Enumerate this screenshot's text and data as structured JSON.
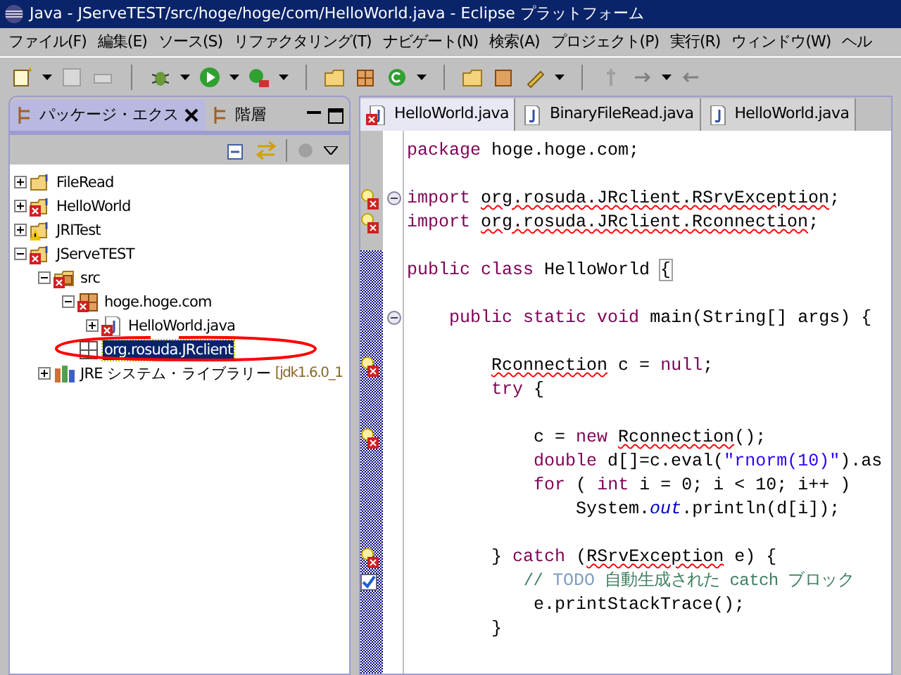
{
  "window": {
    "title": "Java - JServeTEST/src/hoge/hoge/com/HelloWorld.java - Eclipse プラットフォーム"
  },
  "menu": [
    "ファイル(F)",
    "編集(E)",
    "ソース(S)",
    "リファクタリング(T)",
    "ナビゲート(N)",
    "検索(A)",
    "プロジェクト(P)",
    "実行(R)",
    "ウィンドウ(W)",
    "ヘル"
  ],
  "side_tabs": [
    {
      "label": "パッケージ・エクス",
      "selected": true
    },
    {
      "label": "階層",
      "selected": false
    }
  ],
  "tree": [
    {
      "label": "FileRead",
      "kind": "project",
      "error": false,
      "warning": false,
      "expanded": false,
      "selected": false
    },
    {
      "label": "HelloWorld",
      "kind": "project",
      "error": true,
      "warning": false,
      "expanded": false,
      "selected": false
    },
    {
      "label": "JRITest",
      "kind": "project",
      "error": false,
      "warning": true,
      "expanded": false,
      "selected": false
    },
    {
      "label": "JServeTEST",
      "kind": "project",
      "error": true,
      "warning": false,
      "expanded": true,
      "selected": false,
      "children": [
        {
          "label": "src",
          "kind": "folder",
          "error": true,
          "warning": false,
          "expanded": true,
          "selected": false,
          "children": [
            {
              "label": "hoge.hoge.com",
              "kind": "package",
              "error": true,
              "warning": false,
              "expanded": true,
              "selected": false,
              "children": [
                {
                  "label": "HelloWorld.java",
                  "kind": "file",
                  "error": true,
                  "warning": false,
                  "expanded": false,
                  "selected": false
                }
              ]
            },
            {
              "label": "org.rosuda.JRclient",
              "kind": "empty",
              "error": false,
              "warning": false,
              "selected": true
            }
          ]
        },
        {
          "label": "JRE システム・ライブラリー",
          "kind": "library",
          "error": false,
          "warning": false,
          "decoration": "[jdk1.6.0_1",
          "expanded": false,
          "selected": false
        }
      ]
    }
  ],
  "editor_tabs": [
    {
      "label": "HelloWorld.java",
      "error": true,
      "selected": true
    },
    {
      "label": "BinaryFileRead.java",
      "error": false,
      "selected": false
    },
    {
      "label": "HelloWorld.java",
      "error": false,
      "selected": false
    }
  ],
  "code": [
    {
      "kind": "code",
      "error": false,
      "task": false,
      "foldable": false,
      "segments": [
        {
          "kind": "keyword",
          "text": "package"
        },
        {
          "kind": "plain",
          "text": " hoge.hoge.com;"
        }
      ]
    },
    {
      "kind": "blank"
    },
    {
      "kind": "code",
      "error": true,
      "task": false,
      "foldable": true,
      "segments": [
        {
          "kind": "keyword",
          "text": "import "
        },
        {
          "kind": "plain",
          "text": "org.rosuda.JRclient.RSrvException",
          "error": true
        },
        {
          "kind": "plain",
          "text": ";"
        }
      ]
    },
    {
      "kind": "code",
      "error": true,
      "task": false,
      "foldable": false,
      "segments": [
        {
          "kind": "keyword",
          "text": "import "
        },
        {
          "kind": "plain",
          "text": "org.rosuda.JRclient.Rconnection",
          "error": true
        },
        {
          "kind": "plain",
          "text": ";"
        }
      ]
    },
    {
      "kind": "blank"
    },
    {
      "kind": "code",
      "error": false,
      "task": false,
      "foldable": false,
      "segments": [
        {
          "kind": "keyword",
          "text": "public class"
        },
        {
          "kind": "plain",
          "text": " HelloWorld "
        },
        {
          "kind": "bracket",
          "text": "{"
        }
      ]
    },
    {
      "kind": "blank"
    },
    {
      "kind": "code",
      "error": false,
      "task": false,
      "foldable": true,
      "segments": [
        {
          "kind": "keyword",
          "text": "    public static void"
        },
        {
          "kind": "plain",
          "text": " main(String[] args) {"
        }
      ]
    },
    {
      "kind": "blank"
    },
    {
      "kind": "code",
      "error": true,
      "task": false,
      "foldable": false,
      "segments": [
        {
          "kind": "plain",
          "text": "        Rconnection",
          "error": true
        },
        {
          "kind": "plain",
          "text": " c = "
        },
        {
          "kind": "keyword",
          "text": "null"
        },
        {
          "kind": "plain",
          "text": ";"
        }
      ]
    },
    {
      "kind": "code",
      "error": false,
      "task": false,
      "foldable": false,
      "segments": [
        {
          "kind": "keyword",
          "text": "        try"
        },
        {
          "kind": "plain",
          "text": " {"
        }
      ]
    },
    {
      "kind": "blank"
    },
    {
      "kind": "code",
      "error": true,
      "task": false,
      "foldable": false,
      "segments": [
        {
          "kind": "plain",
          "text": "            c = "
        },
        {
          "kind": "keyword",
          "text": "new "
        },
        {
          "kind": "plain",
          "text": "Rconnection",
          "error": true
        },
        {
          "kind": "plain",
          "text": "();"
        }
      ]
    },
    {
      "kind": "code",
      "error": false,
      "task": false,
      "foldable": false,
      "segments": [
        {
          "kind": "keyword",
          "text": "            double"
        },
        {
          "kind": "plain",
          "text": " d[]=c.eval("
        },
        {
          "kind": "string",
          "text": "\"rnorm(10)\""
        },
        {
          "kind": "plain",
          "text": ").as"
        }
      ]
    },
    {
      "kind": "code",
      "error": false,
      "task": false,
      "foldable": false,
      "segments": [
        {
          "kind": "keyword",
          "text": "            for"
        },
        {
          "kind": "plain",
          "text": " ( "
        },
        {
          "kind": "keyword",
          "text": "int"
        },
        {
          "kind": "plain",
          "text": " i = 0; i < 10; i++ )"
        }
      ]
    },
    {
      "kind": "code",
      "error": false,
      "task": false,
      "foldable": false,
      "segments": [
        {
          "kind": "plain",
          "text": "                System."
        },
        {
          "kind": "field",
          "text": "out"
        },
        {
          "kind": "plain",
          "text": ".println(d[i]);"
        }
      ]
    },
    {
      "kind": "blank"
    },
    {
      "kind": "code",
      "error": true,
      "task": false,
      "foldable": false,
      "segments": [
        {
          "kind": "plain",
          "text": "        } "
        },
        {
          "kind": "keyword",
          "text": "catch"
        },
        {
          "kind": "plain",
          "text": " ("
        },
        {
          "kind": "plain",
          "text": "RSrvException",
          "error": true
        },
        {
          "kind": "plain",
          "text": " e) {"
        }
      ]
    },
    {
      "kind": "code",
      "error": false,
      "task": true,
      "foldable": false,
      "segments": [
        {
          "kind": "comment",
          "text": "            // "
        },
        {
          "kind": "task",
          "text": "TODO"
        },
        {
          "kind": "comment",
          "text": " 自動生成された catch ブロック"
        }
      ]
    },
    {
      "kind": "code",
      "error": false,
      "task": false,
      "foldable": false,
      "segments": [
        {
          "kind": "plain",
          "text": "            e.printStackTrace();"
        }
      ]
    },
    {
      "kind": "code",
      "error": false,
      "task": false,
      "foldable": false,
      "segments": [
        {
          "kind": "plain",
          "text": "        }"
        }
      ]
    }
  ]
}
